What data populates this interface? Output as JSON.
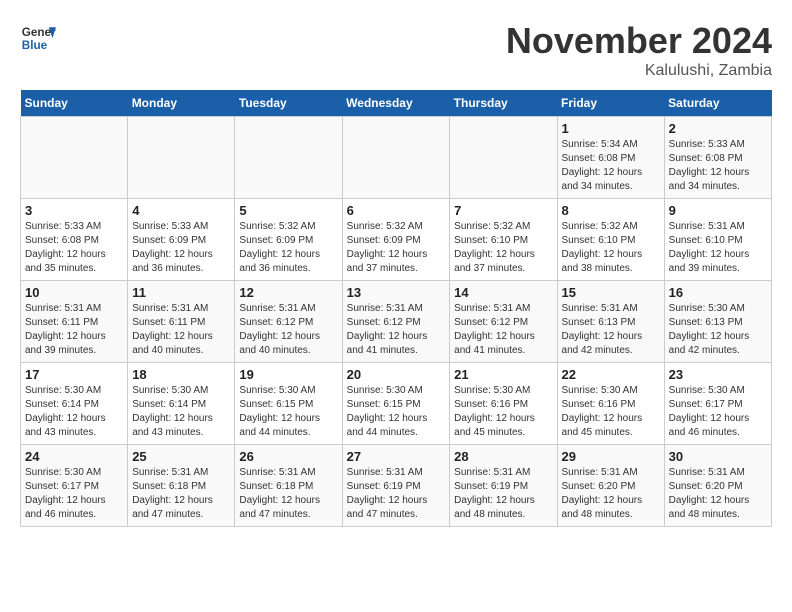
{
  "header": {
    "logo_line1": "General",
    "logo_line2": "Blue",
    "month": "November 2024",
    "location": "Kalulushi, Zambia"
  },
  "weekdays": [
    "Sunday",
    "Monday",
    "Tuesday",
    "Wednesday",
    "Thursday",
    "Friday",
    "Saturday"
  ],
  "weeks": [
    [
      {
        "day": "",
        "info": ""
      },
      {
        "day": "",
        "info": ""
      },
      {
        "day": "",
        "info": ""
      },
      {
        "day": "",
        "info": ""
      },
      {
        "day": "",
        "info": ""
      },
      {
        "day": "1",
        "info": "Sunrise: 5:34 AM\nSunset: 6:08 PM\nDaylight: 12 hours and 34 minutes."
      },
      {
        "day": "2",
        "info": "Sunrise: 5:33 AM\nSunset: 6:08 PM\nDaylight: 12 hours and 34 minutes."
      }
    ],
    [
      {
        "day": "3",
        "info": "Sunrise: 5:33 AM\nSunset: 6:08 PM\nDaylight: 12 hours and 35 minutes."
      },
      {
        "day": "4",
        "info": "Sunrise: 5:33 AM\nSunset: 6:09 PM\nDaylight: 12 hours and 36 minutes."
      },
      {
        "day": "5",
        "info": "Sunrise: 5:32 AM\nSunset: 6:09 PM\nDaylight: 12 hours and 36 minutes."
      },
      {
        "day": "6",
        "info": "Sunrise: 5:32 AM\nSunset: 6:09 PM\nDaylight: 12 hours and 37 minutes."
      },
      {
        "day": "7",
        "info": "Sunrise: 5:32 AM\nSunset: 6:10 PM\nDaylight: 12 hours and 37 minutes."
      },
      {
        "day": "8",
        "info": "Sunrise: 5:32 AM\nSunset: 6:10 PM\nDaylight: 12 hours and 38 minutes."
      },
      {
        "day": "9",
        "info": "Sunrise: 5:31 AM\nSunset: 6:10 PM\nDaylight: 12 hours and 39 minutes."
      }
    ],
    [
      {
        "day": "10",
        "info": "Sunrise: 5:31 AM\nSunset: 6:11 PM\nDaylight: 12 hours and 39 minutes."
      },
      {
        "day": "11",
        "info": "Sunrise: 5:31 AM\nSunset: 6:11 PM\nDaylight: 12 hours and 40 minutes."
      },
      {
        "day": "12",
        "info": "Sunrise: 5:31 AM\nSunset: 6:12 PM\nDaylight: 12 hours and 40 minutes."
      },
      {
        "day": "13",
        "info": "Sunrise: 5:31 AM\nSunset: 6:12 PM\nDaylight: 12 hours and 41 minutes."
      },
      {
        "day": "14",
        "info": "Sunrise: 5:31 AM\nSunset: 6:12 PM\nDaylight: 12 hours and 41 minutes."
      },
      {
        "day": "15",
        "info": "Sunrise: 5:31 AM\nSunset: 6:13 PM\nDaylight: 12 hours and 42 minutes."
      },
      {
        "day": "16",
        "info": "Sunrise: 5:30 AM\nSunset: 6:13 PM\nDaylight: 12 hours and 42 minutes."
      }
    ],
    [
      {
        "day": "17",
        "info": "Sunrise: 5:30 AM\nSunset: 6:14 PM\nDaylight: 12 hours and 43 minutes."
      },
      {
        "day": "18",
        "info": "Sunrise: 5:30 AM\nSunset: 6:14 PM\nDaylight: 12 hours and 43 minutes."
      },
      {
        "day": "19",
        "info": "Sunrise: 5:30 AM\nSunset: 6:15 PM\nDaylight: 12 hours and 44 minutes."
      },
      {
        "day": "20",
        "info": "Sunrise: 5:30 AM\nSunset: 6:15 PM\nDaylight: 12 hours and 44 minutes."
      },
      {
        "day": "21",
        "info": "Sunrise: 5:30 AM\nSunset: 6:16 PM\nDaylight: 12 hours and 45 minutes."
      },
      {
        "day": "22",
        "info": "Sunrise: 5:30 AM\nSunset: 6:16 PM\nDaylight: 12 hours and 45 minutes."
      },
      {
        "day": "23",
        "info": "Sunrise: 5:30 AM\nSunset: 6:17 PM\nDaylight: 12 hours and 46 minutes."
      }
    ],
    [
      {
        "day": "24",
        "info": "Sunrise: 5:30 AM\nSunset: 6:17 PM\nDaylight: 12 hours and 46 minutes."
      },
      {
        "day": "25",
        "info": "Sunrise: 5:31 AM\nSunset: 6:18 PM\nDaylight: 12 hours and 47 minutes."
      },
      {
        "day": "26",
        "info": "Sunrise: 5:31 AM\nSunset: 6:18 PM\nDaylight: 12 hours and 47 minutes."
      },
      {
        "day": "27",
        "info": "Sunrise: 5:31 AM\nSunset: 6:19 PM\nDaylight: 12 hours and 47 minutes."
      },
      {
        "day": "28",
        "info": "Sunrise: 5:31 AM\nSunset: 6:19 PM\nDaylight: 12 hours and 48 minutes."
      },
      {
        "day": "29",
        "info": "Sunrise: 5:31 AM\nSunset: 6:20 PM\nDaylight: 12 hours and 48 minutes."
      },
      {
        "day": "30",
        "info": "Sunrise: 5:31 AM\nSunset: 6:20 PM\nDaylight: 12 hours and 48 minutes."
      }
    ]
  ]
}
